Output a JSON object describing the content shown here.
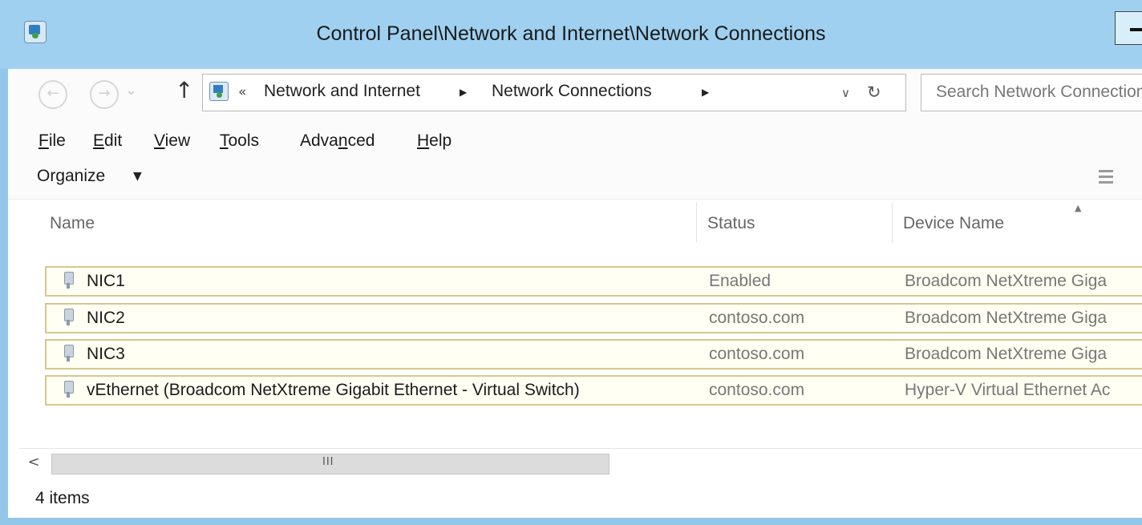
{
  "window": {
    "title": "Control Panel\\Network and Internet\\Network Connections",
    "minimize_glyph": "—"
  },
  "navigation": {
    "back_icon": "back-arrow-icon",
    "forward_icon": "forward-arrow-icon",
    "up_glyph": "↑",
    "breadcrumb_prefix": "«",
    "breadcrumbs": [
      "Network and Internet",
      "Network Connections"
    ],
    "breadcrumb_separator": "▶",
    "search_placeholder": "Search Network Connections"
  },
  "menu": {
    "items": [
      {
        "label": "File",
        "accel": "F"
      },
      {
        "label": "Edit",
        "accel": "E"
      },
      {
        "label": "View",
        "accel": "V"
      },
      {
        "label": "Tools",
        "accel": "T"
      },
      {
        "label": "Advanced",
        "accel": "n"
      },
      {
        "label": "Help",
        "accel": "H"
      }
    ]
  },
  "commandbar": {
    "organize_label": "Organize",
    "organize_caret": "▼"
  },
  "columns": {
    "name": "Name",
    "status": "Status",
    "device": "Device Name"
  },
  "connections": [
    {
      "name": "NIC1",
      "status": "Enabled",
      "device": "Broadcom NetXtreme Giga"
    },
    {
      "name": "NIC2",
      "status": "contoso.com",
      "device": "Broadcom NetXtreme Giga"
    },
    {
      "name": "NIC3",
      "status": "contoso.com",
      "device": "Broadcom NetXtreme Giga"
    },
    {
      "name": "vEthernet (Broadcom NetXtreme Gigabit Ethernet - Virtual Switch)",
      "status": "contoso.com",
      "device": "Hyper-V Virtual Ethernet Ac"
    }
  ],
  "scrollbar": {
    "left_glyph": "<",
    "grip_glyph": "III"
  },
  "status": {
    "item_count": "4 items"
  },
  "colors": {
    "titlebar": "#9fd0f0",
    "row_selected_border": "#d6c88a",
    "row_selected_fill": "#fffff3"
  }
}
